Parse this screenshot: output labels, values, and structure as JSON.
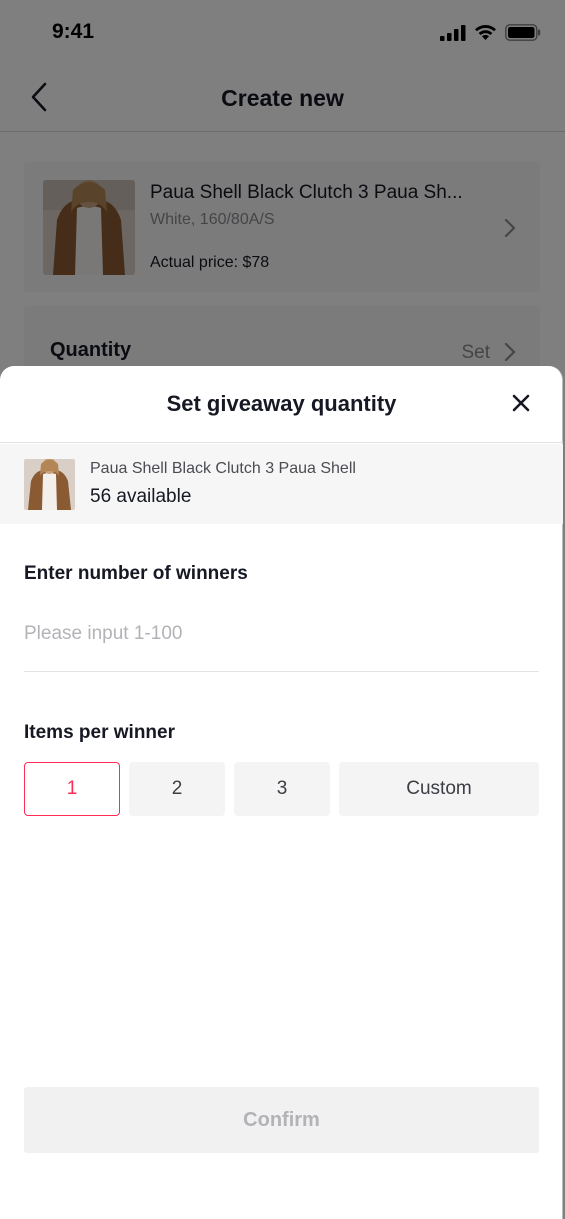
{
  "status_bar": {
    "time": "9:41",
    "icons": [
      "signal-icon",
      "wifi-icon",
      "battery-icon"
    ]
  },
  "nav": {
    "title": "Create new",
    "back_icon": "chevron-left-icon"
  },
  "product": {
    "name": "Paua Shell Black Clutch 3 Paua Sh...",
    "variant": "White, 160/80A/S",
    "price": "Actual price: $78"
  },
  "quantity": {
    "label": "Quantity",
    "action": "Set"
  },
  "sheet": {
    "title": "Set giveaway quantity",
    "close_icon": "close-icon",
    "item": {
      "name": "Paua Shell Black Clutch 3 Paua Shell",
      "available": "56 available"
    },
    "winners": {
      "label": "Enter number of winners",
      "placeholder": "Please input 1-100",
      "value": ""
    },
    "items_per_winner": {
      "label": "Items per winner",
      "options": [
        "1",
        "2",
        "3",
        "Custom"
      ],
      "selected": "1"
    },
    "confirm_label": "Confirm"
  },
  "colors": {
    "accent": "#fe2c55",
    "disabled_text": "#b3b3b7",
    "card_bg": "#f6f6f6"
  }
}
